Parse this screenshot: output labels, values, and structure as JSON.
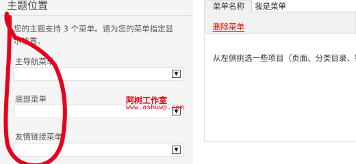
{
  "locations_panel": {
    "title": "主题位置",
    "description": "您的主题支持 3 个菜单。请为您的菜单指定显示位置。",
    "locations": [
      {
        "label": "主导航菜单",
        "selected": ""
      },
      {
        "label": "底部菜单",
        "selected": ""
      },
      {
        "label": "友情链接菜单",
        "selected": ""
      }
    ],
    "watermark_name": "阿树工作室",
    "watermark_url": "www.ashuwp.com"
  },
  "menu_editor": {
    "name_label": "菜单名称",
    "name_value": "我是菜单",
    "delete_link": "删除菜单",
    "hint": "从左侧挑选一些项目（页面、分类目录、链"
  },
  "colors": {
    "accent_red": "#e60012",
    "scribble_red": "#e8001c"
  }
}
